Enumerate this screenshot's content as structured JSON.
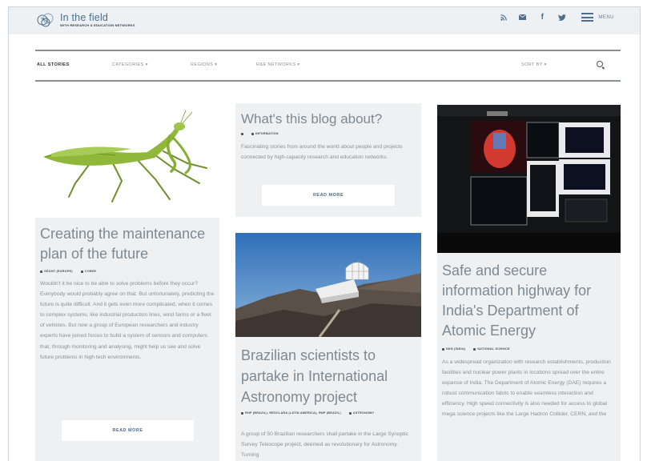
{
  "header": {
    "logo_title": "In the field",
    "logo_subtitle": "WITH RESEARCH & EDUCATION NETWORKS",
    "social_icons": [
      "rss-icon",
      "email-icon",
      "facebook-icon",
      "twitter-icon"
    ],
    "menu_label": "MENU"
  },
  "nav": {
    "all_stories": "ALL STORIES",
    "categories": "CATEGORIES ▾",
    "regions": "REGIONS ▾",
    "re_networks": "R&E NETWORKS ▾",
    "sort_by": "SORT BY ▾"
  },
  "cards": {
    "about": {
      "title": "What's this blog about?",
      "tag": "INFORMATION",
      "excerpt": "Fascinating stories from around the world about people and projects connected by high-capacity research and education networks.",
      "button": "READ MORE"
    },
    "maintenance": {
      "title": "Creating the maintenance plan of the future",
      "region": "GÉANT (EUROPE)",
      "tag": "CYBER",
      "excerpt": "Wouldn't it be nice to be able to solve problems before they occur? Everybody would probably agree on that. But unfortunately, predicting the future is quite difficult. And it gets even more complicated, when it comes to complex systems, like industrial production lines, wind farms or a fleet of vehicles. But now a group of European researchers and industry experts have joined forces to build a system of sensors and computers that, through monitoring and analysing, might help us see and solve future problems in high tech environments.",
      "button": "READ MORE"
    },
    "astronomy": {
      "title": "Brazilian scientists to partake in International Astronomy project",
      "region": "RNP (BRAZIL), REDCLARA (LATIN AMERICA), RNP (BRAZIL)",
      "tag": "ASTRONOMY",
      "excerpt": "A group of 50 Brazilian researchers shall partake in the Large Synoptic Survey Telescope project, deemed as revolutionary for Astronomy. Turning"
    },
    "india": {
      "title": "Safe and secure information highway for India's Department of Atomic Energy",
      "region": "NKN (INDIA)",
      "tag": "NATIONAL SCIENCE",
      "excerpt": "As a widespread organization with research establishments, production facilities and nuclear power plants in locations spread over the entire expanse of India, The Department of Atomic Energy (DAE) requires a robust communication fabric to enable seamless interaction and efficiency. High speed connectivity is also needed for access to global mega science projects like the Large Hadron Collider, CERN, and the"
    }
  },
  "colors": {
    "header_bg": "#eef1f4",
    "card_bg": "#eef0f2",
    "title_text": "#7d8a94",
    "accent_blue": "#4e6b89"
  }
}
